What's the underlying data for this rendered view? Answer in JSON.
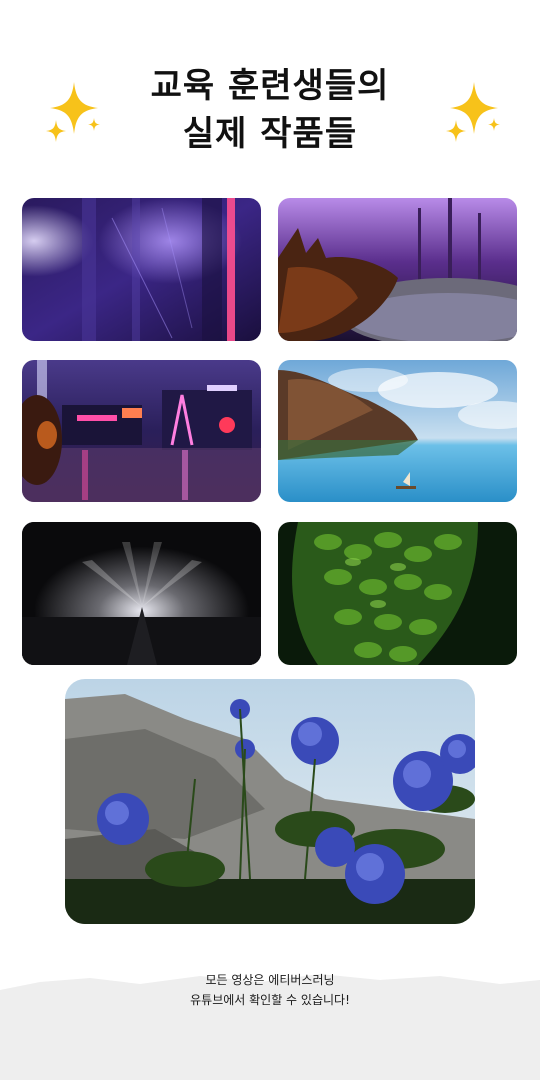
{
  "heading": {
    "line1": "교육 훈련생들의",
    "line2": "실제 작품들"
  },
  "decorations": {
    "left": "sparkles-icon",
    "right": "sparkles-icon",
    "sparkle_color": "#f7c21a"
  },
  "gallery": {
    "items": [
      {
        "scene": "neon-purple-corridor"
      },
      {
        "scene": "fox-in-purple-forest"
      },
      {
        "scene": "neon-city-night"
      },
      {
        "scene": "shipwreck-on-sea"
      },
      {
        "scene": "dark-stage-light-beams"
      },
      {
        "scene": "green-ivy-leaves"
      },
      {
        "scene": "blue-hydrangea-rocks"
      }
    ]
  },
  "footer": {
    "line1": "모든 영상은 에티버스러닝",
    "line2": "유튜브에서 확인할 수 있습니다!"
  }
}
